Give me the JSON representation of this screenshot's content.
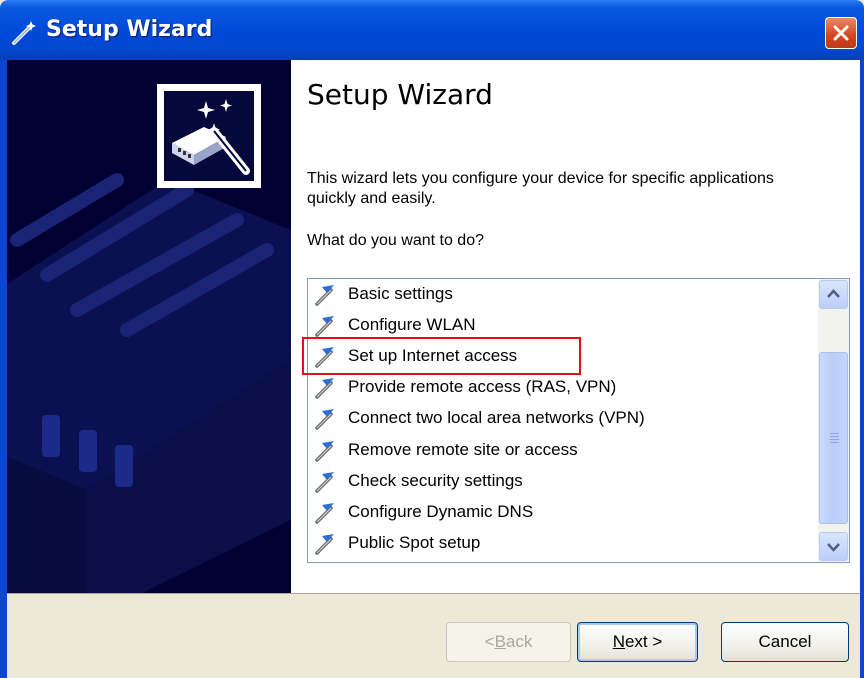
{
  "window": {
    "title": "Setup Wizard",
    "title_icon": "wizard-wand-icon",
    "close_icon": "close-icon"
  },
  "sidepanel": {
    "logo_icon": "wizard-router-logo-icon"
  },
  "content": {
    "heading": "Setup Wizard",
    "description": "This wizard lets you configure your device for specific applications quickly and easily.",
    "question": "What do you want to do?"
  },
  "list": {
    "item_icon": "wizard-wand-icon",
    "items": [
      {
        "label": "Basic settings"
      },
      {
        "label": "Configure WLAN"
      },
      {
        "label": "Set up Internet access"
      },
      {
        "label": "Provide remote access (RAS, VPN)"
      },
      {
        "label": "Connect two local area networks (VPN)"
      },
      {
        "label": "Remove remote site or access"
      },
      {
        "label": "Check security settings"
      },
      {
        "label": "Configure Dynamic DNS"
      },
      {
        "label": "Public Spot setup"
      }
    ],
    "highlighted_item": "Set up Internet access",
    "highlight_color": "#e0111a"
  },
  "buttons": {
    "back": {
      "pre": "< ",
      "key": "B",
      "rest": "ack"
    },
    "next": {
      "key": "N",
      "rest": "ext >"
    },
    "cancel": "Cancel"
  },
  "colors": {
    "titlebar": "#0049d8",
    "sidepanel": "#000033",
    "dialog_bg": "#ece9d8"
  }
}
